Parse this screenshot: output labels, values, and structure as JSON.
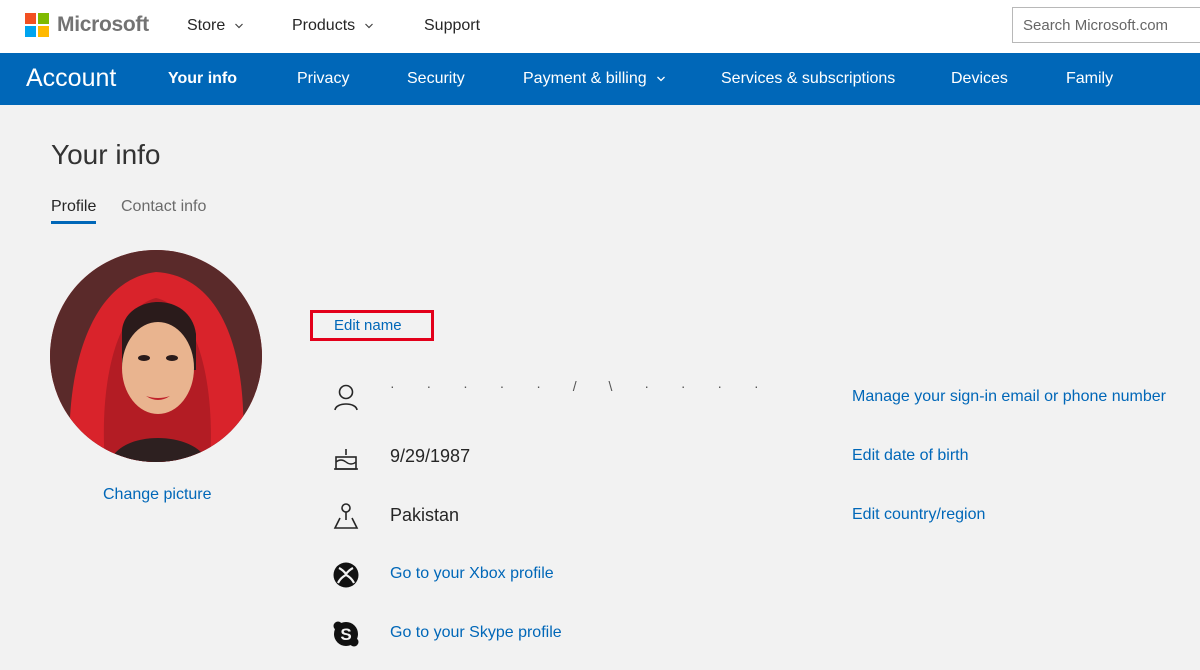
{
  "header": {
    "brand": "Microsoft",
    "logo_colors": [
      "#f25022",
      "#7fba00",
      "#00a4ef",
      "#ffb900"
    ],
    "nav": [
      {
        "label": "Store",
        "has_dropdown": true
      },
      {
        "label": "Products",
        "has_dropdown": true
      },
      {
        "label": "Support",
        "has_dropdown": false
      }
    ],
    "search_placeholder": "Search Microsoft.com"
  },
  "account_nav": {
    "brand": "Account",
    "accent_color": "#0067b8",
    "items": [
      {
        "label": "Your info",
        "active": true
      },
      {
        "label": "Privacy"
      },
      {
        "label": "Security"
      },
      {
        "label": "Payment & billing",
        "has_dropdown": true
      },
      {
        "label": "Services & subscriptions"
      },
      {
        "label": "Devices"
      },
      {
        "label": "Family"
      }
    ]
  },
  "page": {
    "title": "Your info",
    "tabs": [
      {
        "label": "Profile",
        "active": true
      },
      {
        "label": "Contact info"
      }
    ],
    "change_picture": "Change picture",
    "edit_name": "Edit name",
    "highlight_color": "#e3001b",
    "rows": [
      {
        "icon": "person-icon",
        "value": "· · · · · / \\ · · · ·",
        "link": "Manage your sign-in email or phone number"
      },
      {
        "icon": "birthday-cake-icon",
        "value": "9/29/1987",
        "link": "Edit date of birth"
      },
      {
        "icon": "location-pin-icon",
        "value": "Pakistan",
        "link": "Edit country/region"
      },
      {
        "icon": "xbox-icon",
        "link_text": "Go to your Xbox profile"
      },
      {
        "icon": "skype-icon",
        "link_text": "Go to your Skype profile"
      }
    ]
  }
}
